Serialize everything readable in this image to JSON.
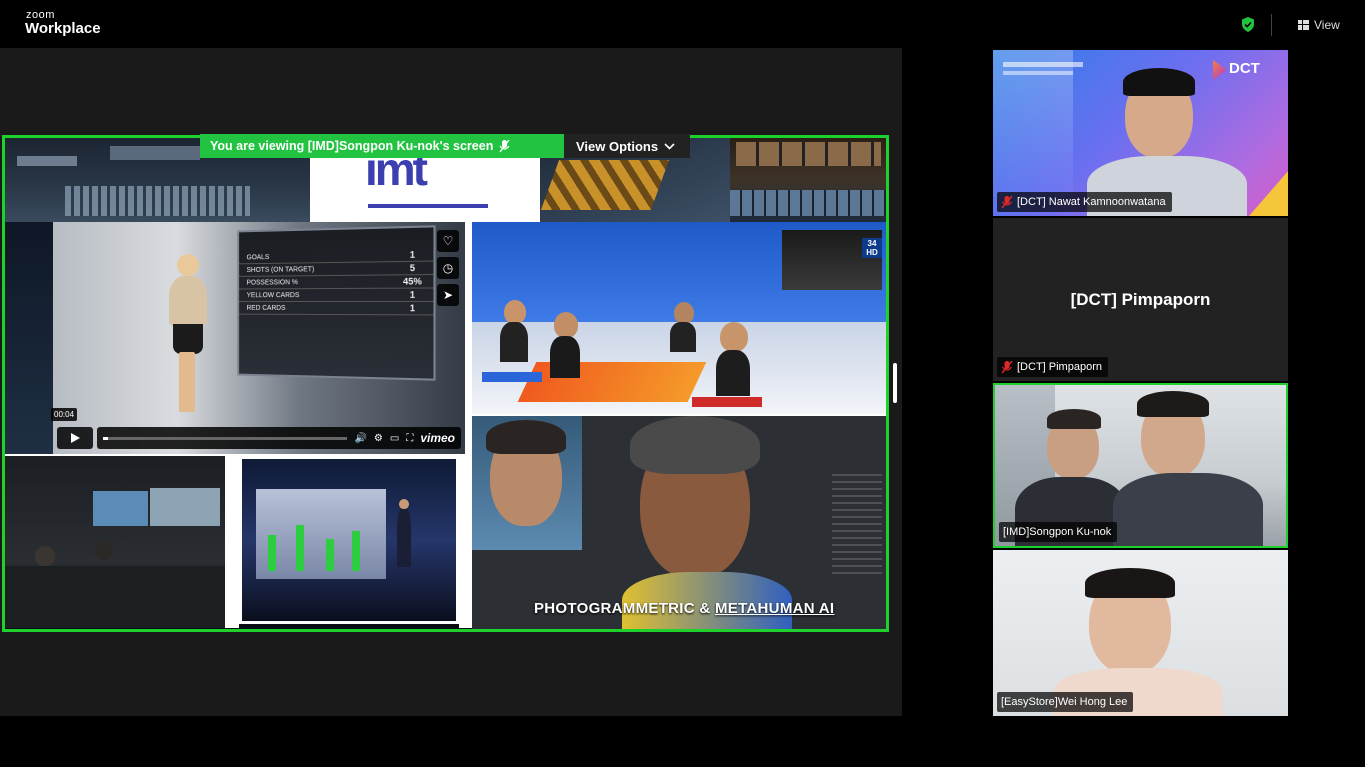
{
  "app": {
    "logo_small": "zoom",
    "logo_big": "Workplace",
    "view_label": "View"
  },
  "share": {
    "viewing_text": "You are viewing  [IMD]Songpon Ku-nok's screen",
    "options_label": "View Options",
    "video_time": "00:04",
    "video_progress": 0.02,
    "vimeo": "vimeo",
    "imt_logo": "imt",
    "caption_part1": "PHOTOGRAMMETRIC & ",
    "caption_part2": "METAHUMAN AI",
    "scoreboard": [
      {
        "label": "GOALS",
        "value": "1"
      },
      {
        "label": "SHOTS (ON TARGET)",
        "value": "5"
      },
      {
        "label": "POSSESSION %",
        "value": "45%"
      },
      {
        "label": "YELLOW CARDS",
        "value": "1"
      },
      {
        "label": "RED CARDS",
        "value": "1"
      }
    ],
    "channel_badge": "34 HD"
  },
  "participants": [
    {
      "name": "[DCT] Nawat Kamnoonwatana",
      "muted": true,
      "brand": "DCT"
    },
    {
      "name": "[DCT] Pimpaporn",
      "display_name": "[DCT] Pimpaporn",
      "muted": true
    },
    {
      "name": "[IMD]Songpon Ku-nok",
      "muted": false,
      "active_speaker": true
    },
    {
      "name": "[EasyStore]Wei Hong Lee",
      "muted": false
    }
  ],
  "colors": {
    "share_border": "#1fd12c",
    "banner_green": "#23c342",
    "mute_red": "#e02828"
  }
}
